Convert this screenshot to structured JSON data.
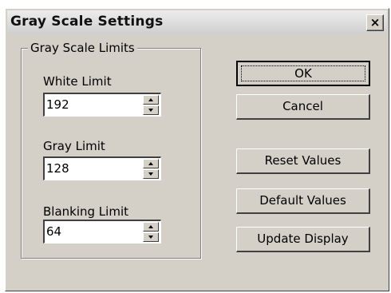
{
  "window": {
    "title": "Gray Scale Settings",
    "close_glyph": "×"
  },
  "group": {
    "title": "Gray Scale Limits",
    "fields": [
      {
        "label": "White Limit",
        "value": "192"
      },
      {
        "label": "Gray Limit",
        "value": "128"
      },
      {
        "label": "Blanking Limit",
        "value": "64"
      }
    ]
  },
  "buttons": {
    "ok": "OK",
    "cancel": "Cancel",
    "reset": "Reset Values",
    "default": "Default Values",
    "update": "Update Display"
  },
  "icons": {
    "close": "close-icon",
    "spin_up": "spin-up-icon",
    "spin_down": "spin-down-icon"
  }
}
